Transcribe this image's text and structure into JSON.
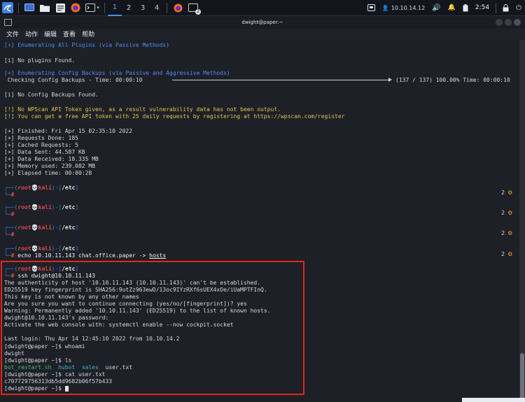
{
  "panel": {
    "workspaces": [
      "1",
      "2",
      "3",
      "4"
    ],
    "active_workspace": "1",
    "ip_address": "10.10.14.12",
    "clock": "2:54",
    "notification_count": "2",
    "accent": "#4c8df0"
  },
  "window": {
    "title": "dwight@paper:~",
    "menu": [
      "文件",
      "动作",
      "编辑",
      "查看",
      "帮助"
    ]
  },
  "terminal": {
    "enum_plugins": "[+] Enumerating All Plugins (via Passive Methods)",
    "no_plugins": "[i] No plugins Found.",
    "enum_config": "[+] Enumerating Config Backups (via Passive and Aggressive Methods)",
    "check_backups": " Checking Config Backups - Time: 00:00:10 ",
    "progress_text": "(137 / 137) 100.00% Time: 00:00:10",
    "no_backups": "[i] No Config Backups Found.",
    "no_token": "[!] No WPScan API Token given, as a result vulnerability data has not been output.",
    "free_token": "[!] You can get a free API token with 25 daily requests by registering at https://wpscan.com/register",
    "finished": "[+] Finished: Fri Apr 15 02:35:10 2022",
    "requests_done": "[+] Requests Done: 185",
    "cached": "[+] Cached Requests: 5",
    "data_sent": "[+] Data Sent: 44.587 KB",
    "data_received": "[+] Data Received: 18.335 MB",
    "memory": "[+] Memory used: 239.082 MB",
    "elapsed": "[+] Elapsed time: 00:00:28",
    "prompt_user": "root",
    "prompt_host": "kali",
    "prompt_dir": "/etc",
    "echo_cmd": "echo 10.10.11.143 chat.office.paper -> ",
    "echo_target": "hosts",
    "badge_count": "2",
    "ssh_cmd": "ssh dwight@10.10.11.143",
    "ssh_lines": [
      "The authenticity of host '10.10.11.143 (10.10.11.143)' can't be established.",
      "ED25519 key fingerprint is SHA256:9utZz963ewD/13oc9IYzRXf6sUEX4xOe/iUaMPTFInQ.",
      "This key is not known by any other names",
      "Are you sure you want to continue connecting (yes/no/[fingerprint])? yes",
      "Warning: Permanently added '10.10.11.143' (ED25519) to the list of known hosts.",
      "dwight@10.10.11.143's password:",
      "Activate the web console with: systemctl enable --now cockpit.socket",
      "",
      "Last login: Thu Apr 14 12:45:10 2022 from 10.10.14.2"
    ],
    "remote_prompt": "[dwight@paper ~]$ ",
    "cmd_whoami": "whoami",
    "out_whoami": "dwight",
    "cmd_ls": "ls",
    "ls_items": [
      "bot_restart.sh",
      "hubot",
      "sales",
      "user.txt"
    ],
    "cmd_cat": "cat user.txt",
    "out_cat": "c707729756313db5dd9682b06f57b433"
  }
}
